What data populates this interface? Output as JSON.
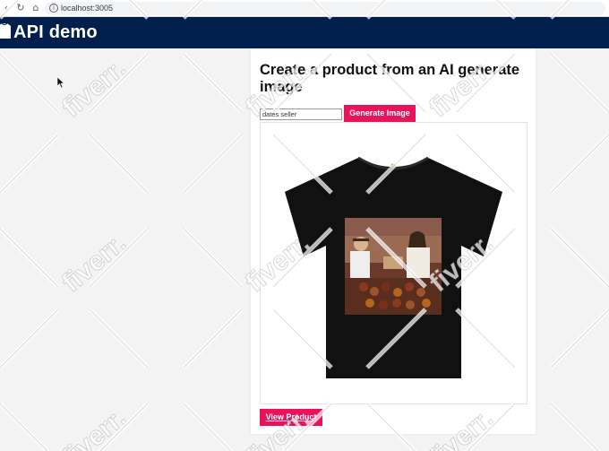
{
  "browser": {
    "url": "localhost:3005",
    "back_icon": "back-arrow-icon",
    "reload_icon": "reload-icon",
    "home_icon": "home-icon",
    "info_icon": "info-icon"
  },
  "header": {
    "title": "API demo",
    "background": "#001f4d",
    "logo_icon": "shirt-logo-icon"
  },
  "main": {
    "title": "Create a product from an AI generate image",
    "prompt_input": {
      "value": "dates seller",
      "placeholder": ""
    },
    "generate_button": "Generate Image",
    "view_button": "View Product",
    "accent": "#e8135c",
    "product_image": "black-tshirt-with-dates-market-print"
  },
  "watermark": {
    "text": "fiverr."
  }
}
